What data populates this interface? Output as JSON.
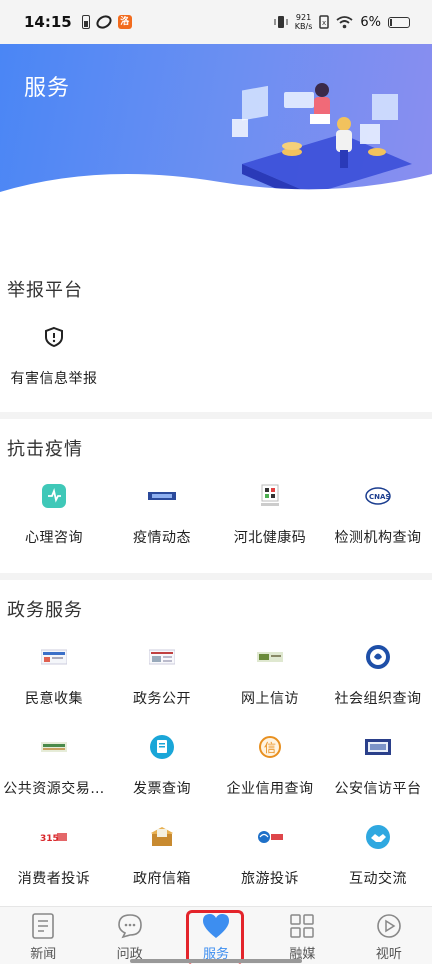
{
  "status_bar": {
    "time": "14:15",
    "speed_value": "921",
    "speed_unit": "KB/s",
    "battery": "6%"
  },
  "banner": {
    "title": "服务"
  },
  "sections": [
    {
      "title": "举报平台",
      "items": [
        {
          "label": "有害信息举报",
          "icon": "shield-alert-icon"
        }
      ]
    },
    {
      "title": "抗击疫情",
      "items": [
        {
          "label": "心理咨询",
          "icon": "counseling-icon"
        },
        {
          "label": "疫情动态",
          "icon": "epidemic-news-icon"
        },
        {
          "label": "河北健康码",
          "icon": "health-code-icon"
        },
        {
          "label": "检测机构查询",
          "icon": "cnas-icon"
        }
      ]
    },
    {
      "title": "政务服务",
      "items": [
        {
          "label": "民意收集",
          "icon": "opinion-icon"
        },
        {
          "label": "政务公开",
          "icon": "gov-affairs-icon"
        },
        {
          "label": "网上信访",
          "icon": "online-petition-icon"
        },
        {
          "label": "社会组织查询",
          "icon": "social-org-icon"
        },
        {
          "label": "公共资源交易…",
          "icon": "public-resource-icon"
        },
        {
          "label": "发票查询",
          "icon": "invoice-icon"
        },
        {
          "label": "企业信用查询",
          "icon": "credit-icon"
        },
        {
          "label": "公安信访平台",
          "icon": "police-petition-icon"
        },
        {
          "label": "消费者投诉",
          "icon": "consumer-icon"
        },
        {
          "label": "政府信箱",
          "icon": "mailbox-icon"
        },
        {
          "label": "旅游投诉",
          "icon": "tourism-icon"
        },
        {
          "label": "互动交流",
          "icon": "handshake-icon"
        }
      ]
    }
  ],
  "bottom_nav": {
    "items": [
      {
        "label": "新闻",
        "icon": "news-icon"
      },
      {
        "label": "问政",
        "icon": "chat-icon"
      },
      {
        "label": "服务",
        "icon": "heart-icon",
        "active": true
      },
      {
        "label": "融媒",
        "icon": "grid-icon"
      },
      {
        "label": "视听",
        "icon": "play-icon"
      }
    ]
  },
  "colors": {
    "accent": "#3d8ef0",
    "banner_start": "#4a86f5",
    "banner_end": "#8a8ef0",
    "highlight": "#e3242b"
  }
}
